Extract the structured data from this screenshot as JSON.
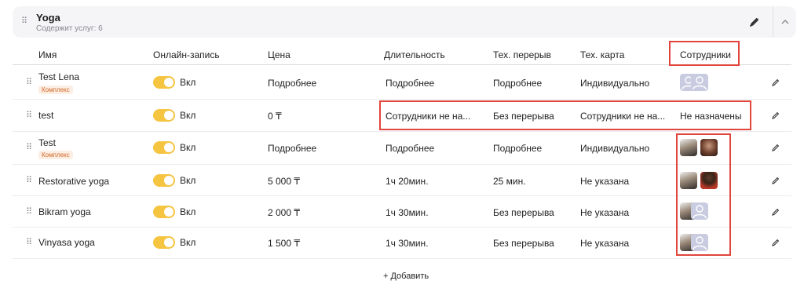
{
  "group": {
    "title": "Yoga",
    "subtitle": "Содержит услуг: 6"
  },
  "columns": {
    "name": "Имя",
    "online": "Онлайн-запись",
    "price": "Цена",
    "duration": "Длительность",
    "break": "Тех. перерыв",
    "card": "Тех. карта",
    "staff": "Сотрудники"
  },
  "rows": [
    {
      "name": "Test Lena",
      "badge": "Комплекс",
      "online": "Вкл",
      "price": "Подробнее",
      "duration": "Подробнее",
      "break": "Подробнее",
      "card": "Индивидуально",
      "staff_text": ""
    },
    {
      "name": "test",
      "badge": "",
      "online": "Вкл",
      "price": "0 ₸",
      "duration": "Сотрудники не на...",
      "break": "Без перерыва",
      "card": "Сотрудники не на...",
      "staff_text": "Не назначены"
    },
    {
      "name": "Test",
      "badge": "Комплекс",
      "online": "Вкл",
      "price": "Подробнее",
      "duration": "Подробнее",
      "break": "Подробнее",
      "card": "Индивидуально",
      "staff_text": ""
    },
    {
      "name": "Restorative yoga",
      "badge": "",
      "online": "Вкл",
      "price": "5 000 ₸",
      "duration": "1ч 20мин.",
      "break": "25 мин.",
      "card": "Не указана",
      "staff_text": ""
    },
    {
      "name": "Bikram yoga",
      "badge": "",
      "online": "Вкл",
      "price": "2 000 ₸",
      "duration": "1ч 30мин.",
      "break": "Без перерыва",
      "card": "Не указана",
      "staff_text": ""
    },
    {
      "name": "Vinyasa yoga",
      "badge": "",
      "online": "Вкл",
      "price": "1 500 ₸",
      "duration": "1ч 30мин.",
      "break": "Без перерыва",
      "card": "Не указана",
      "staff_text": ""
    }
  ],
  "add_label": "+ Добавить",
  "colors": {
    "accent": "#f5c542",
    "highlight": "#e0463c",
    "badge_text": "#d06a2a",
    "badge_bg": "#fdeee3"
  },
  "icons": {
    "drag": "drag-handle-icon",
    "edit": "pencil-icon",
    "collapse": "chevron-up-icon",
    "placeholder": "user-placeholder-icon"
  }
}
